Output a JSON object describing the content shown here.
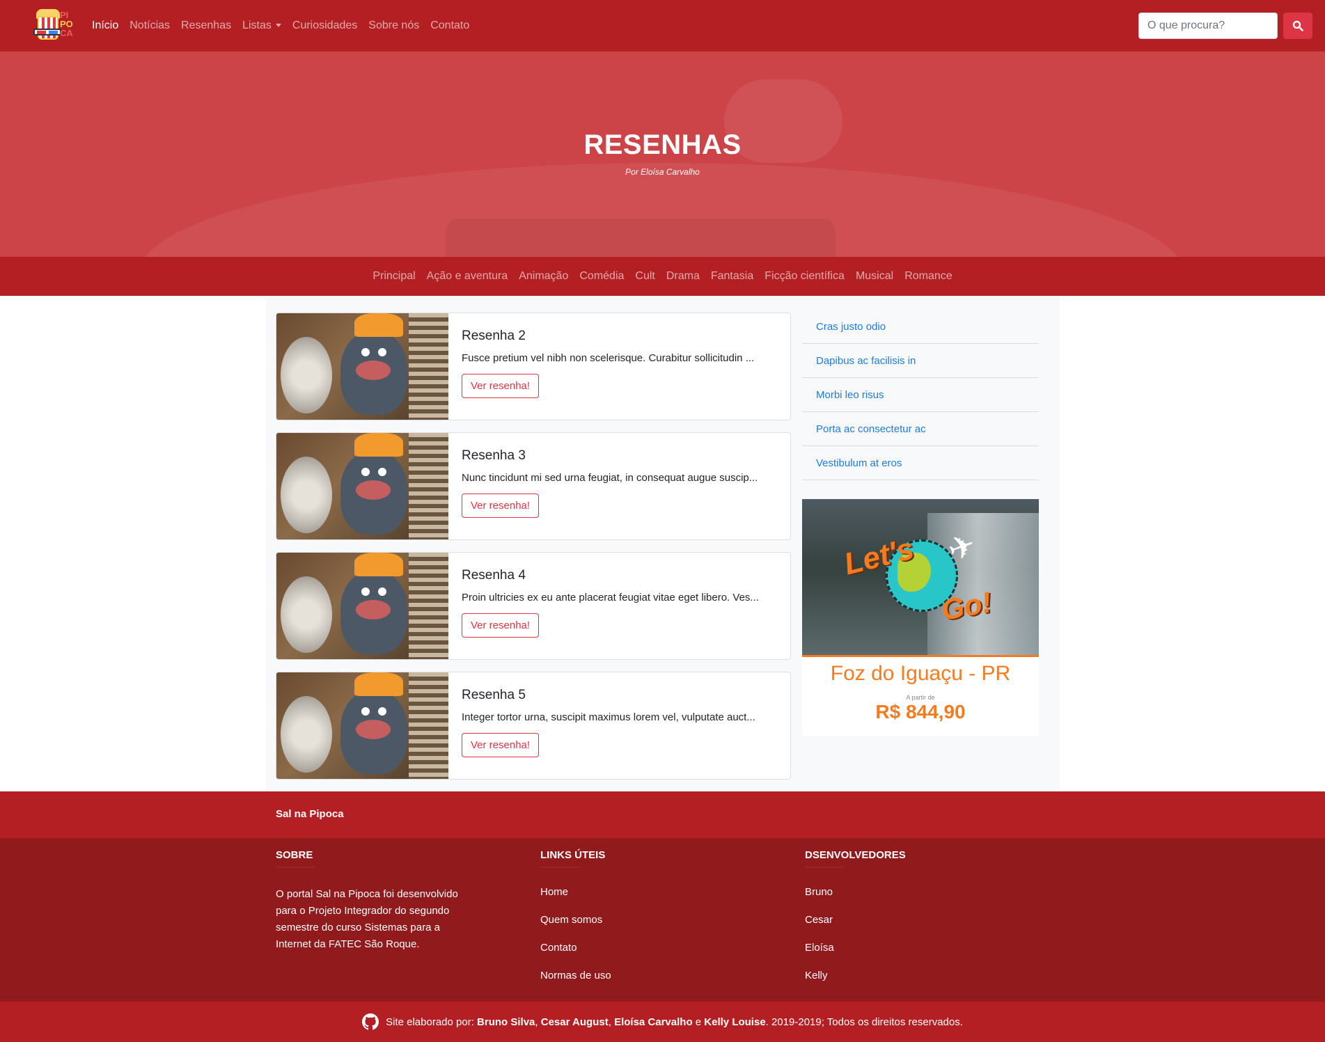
{
  "navbar": {
    "logo_letters": [
      "PI",
      "PO",
      "CA"
    ],
    "links": [
      {
        "label": "Início",
        "active": true
      },
      {
        "label": "Notícias"
      },
      {
        "label": "Resenhas"
      },
      {
        "label": "Listas",
        "dropdown": true
      },
      {
        "label": "Curiosidades"
      },
      {
        "label": "Sobre nós"
      },
      {
        "label": "Contato"
      }
    ],
    "search_placeholder": "O que procura?",
    "search_icon": "search-icon"
  },
  "hero": {
    "title": "RESENHAS",
    "byline": "Por Eloísa Carvalho"
  },
  "categories": [
    "Principal",
    "Ação e aventura",
    "Animação",
    "Comédia",
    "Cult",
    "Drama",
    "Fantasia",
    "Ficção científica",
    "Musical",
    "Romance"
  ],
  "reviews": [
    {
      "title": "Resenha 2",
      "text": "Fusce pretium vel nibh non scelerisque. Curabitur sollicitudin ...",
      "button": "Ver resenha!"
    },
    {
      "title": "Resenha 3",
      "text": "Nunc tincidunt mi sed urna feugiat, in consequat augue suscip...",
      "button": "Ver resenha!"
    },
    {
      "title": "Resenha 4",
      "text": "Proin ultricies ex eu ante placerat feugiat vitae eget libero. Ves...",
      "button": "Ver resenha!"
    },
    {
      "title": "Resenha 5",
      "text": "Integer tortor urna, suscipit maximus lorem vel, vulputate auct...",
      "button": "Ver resenha!"
    }
  ],
  "sidebar_links": [
    "Cras justo odio",
    "Dapibus ac facilisis in",
    "Morbi leo risus",
    "Porta ac consectetur ac",
    "Vestibulum at eros"
  ],
  "ad": {
    "lets": "Let's",
    "go": "Go!",
    "city": "Foz do Iguaçu - PR",
    "from": "A partir de",
    "price": "R$ 844,90"
  },
  "footer": {
    "brand": "Sal na Pipoca",
    "about_title": "SOBRE",
    "about_text": "O portal Sal na Pipoca foi desenvolvido para o Projeto Integrador do segundo semestre do curso Sistemas para a Internet da FATEC São Roque.",
    "links_title": "LINKS ÚTEIS",
    "links": [
      "Home",
      "Quem somos",
      "Contato",
      "Normas de uso"
    ],
    "devs_title": "DSENVOLVEDORES",
    "devs": [
      "Bruno",
      "Cesar",
      "Eloísa",
      "Kelly"
    ],
    "credit_prefix": "Site elaborado por:",
    "credit_names": [
      "Bruno Silva",
      "Cesar August",
      "Eloísa Carvalho",
      "Kelly Louise"
    ],
    "credit_sep1": ",",
    "credit_sep2": ",",
    "credit_and": "e",
    "credit_suffix": ". 2019-2019; Todos os direitos reservados.",
    "github_icon": "github-icon"
  },
  "colors": {
    "primary_red": "#b31f22",
    "dark_red": "#901a1c",
    "danger": "#dc3545",
    "link_blue": "#1f7ae0",
    "ad_orange": "#f47c20"
  }
}
